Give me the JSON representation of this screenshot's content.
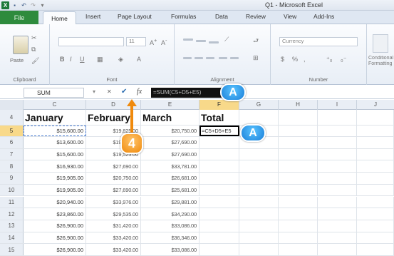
{
  "window": {
    "title": "Q1 - Microsoft Excel",
    "qat": [
      "Save",
      "Undo",
      "Redo"
    ]
  },
  "ribbon": {
    "tabs": [
      "File",
      "Home",
      "Insert",
      "Page Layout",
      "Formulas",
      "Data",
      "Review",
      "View",
      "Add-Ins"
    ],
    "groups": {
      "clipboard": "Clipboard",
      "font": "Font",
      "alignment": "Alignment",
      "number": "Number"
    },
    "paste_label": "Paste",
    "font_size": "11",
    "number_format": "Currency",
    "conditional": "Conditional Formatting"
  },
  "formula_bar": {
    "name_box": "SUM",
    "cancel": "✕",
    "enter": "✔",
    "fx": "fx",
    "formula": "=SUM(C5+D5+E5)"
  },
  "columns": [
    "C",
    "D",
    "E",
    "F",
    "G",
    "H",
    "I",
    "J"
  ],
  "selected_column": "F",
  "rows": [
    {
      "num": "4",
      "c": "January",
      "d": "February",
      "e": "March",
      "f": "Total",
      "header": true
    },
    {
      "num": "5",
      "c": "$15,600.00",
      "d": "$19,825.00",
      "e": "$20,750.00",
      "f": "=C5+D5+E5",
      "active": true
    },
    {
      "num": "6",
      "c": "$13,600.00",
      "d": "$19,825.00",
      "e": "$27,690.00"
    },
    {
      "num": "7",
      "c": "$15,600.00",
      "d": "$19,525.00",
      "e": "$27,690.00"
    },
    {
      "num": "8",
      "c": "$16,930.00",
      "d": "$27,690.00",
      "e": "$33,781.00"
    },
    {
      "num": "9",
      "c": "$19,905.00",
      "d": "$20,750.00",
      "e": "$26,681.00"
    },
    {
      "num": "10",
      "c": "$19,905.00",
      "d": "$27,690.00",
      "e": "$25,681.00"
    },
    {
      "num": "11",
      "c": "$20,940.00",
      "d": "$33,976.00",
      "e": "$29,881.00"
    },
    {
      "num": "12",
      "c": "$23,860.00",
      "d": "$29,535.00",
      "e": "$34,290.00"
    },
    {
      "num": "13",
      "c": "$26,900.00",
      "d": "$31,420.00",
      "e": "$33,086.00"
    },
    {
      "num": "14",
      "c": "$26,900.00",
      "d": "$33,420.00",
      "e": "$36,346.00"
    },
    {
      "num": "15",
      "c": "$26,900.00",
      "d": "$33,420.00",
      "e": "$33,086.00"
    }
  ],
  "callouts": {
    "a1": "A",
    "a2": "A",
    "step": "4"
  },
  "colors": {
    "file_tab": "#2e8b3d",
    "selected_header": "#f8d98a",
    "callout_blue": "#1a7fd9",
    "callout_orange": "#f08a0c"
  }
}
